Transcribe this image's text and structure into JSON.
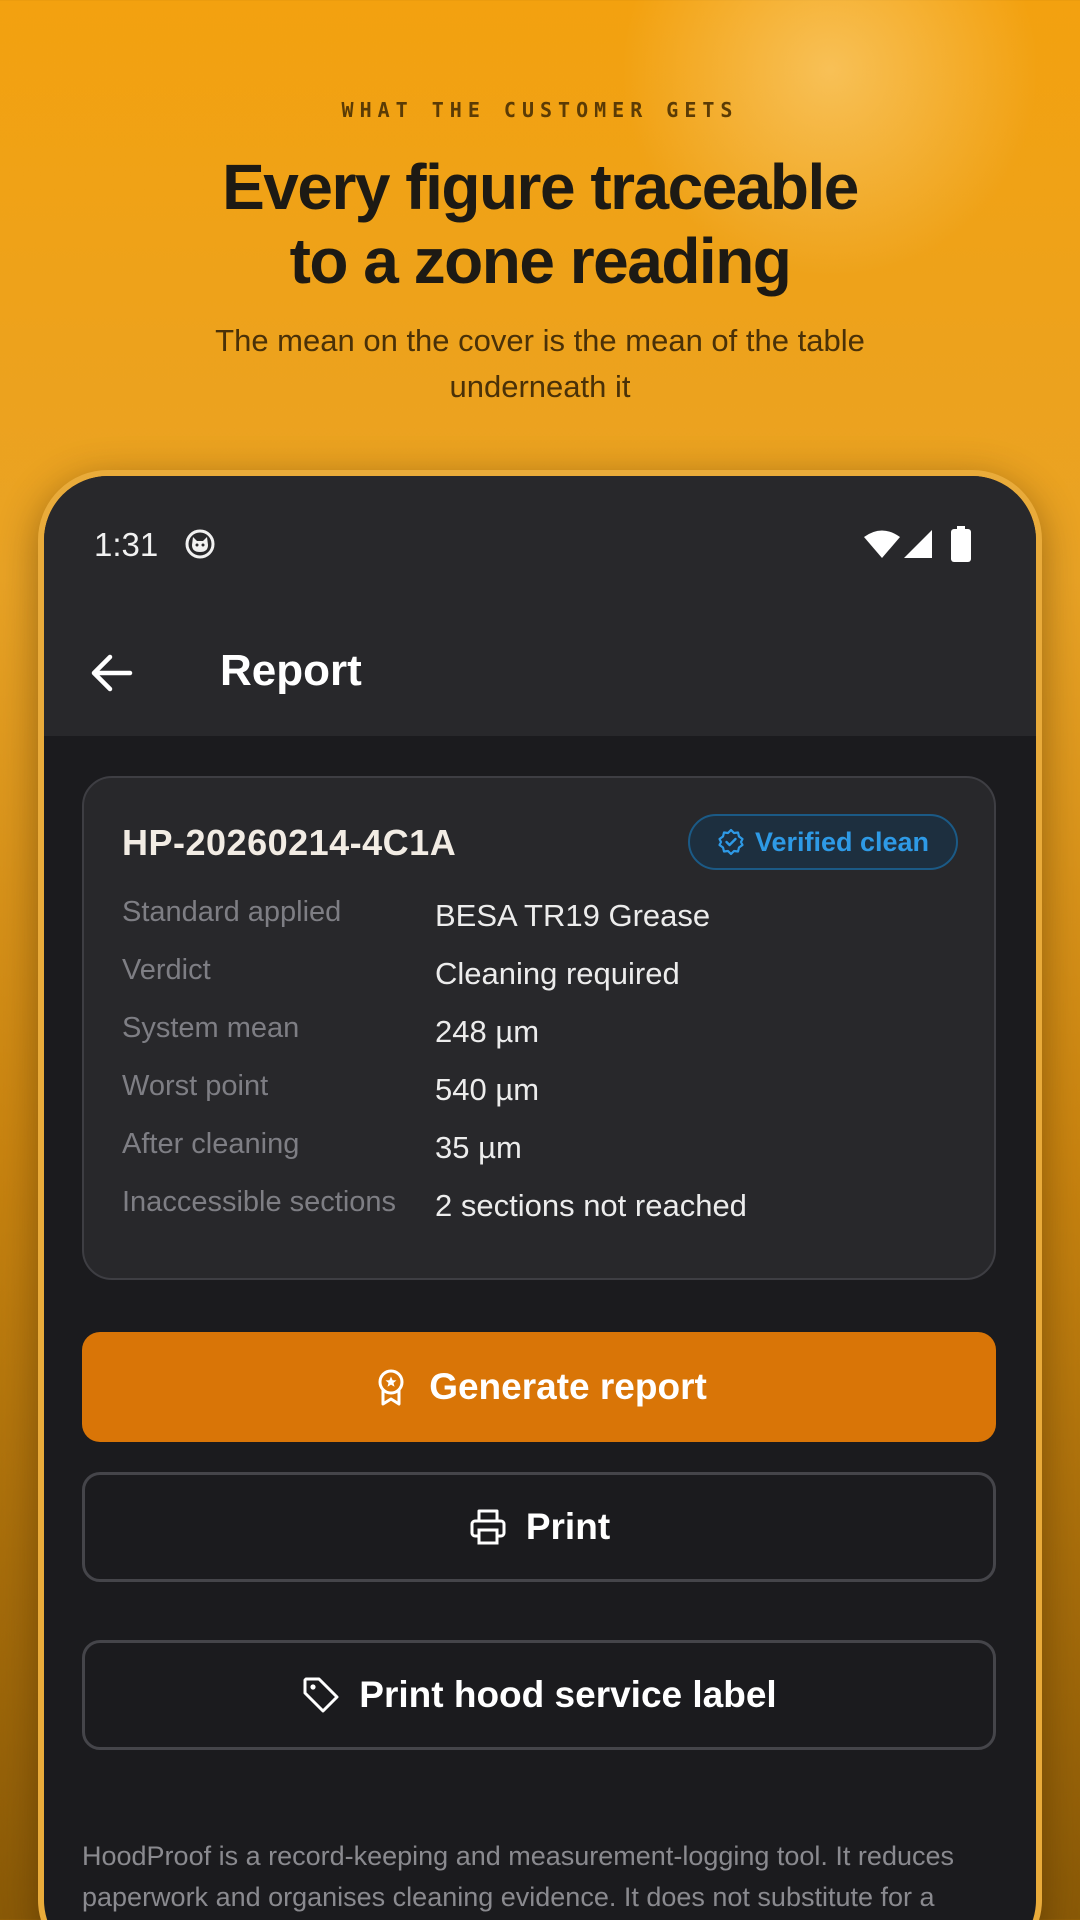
{
  "marketing": {
    "eyebrow": "WHAT THE CUSTOMER GETS",
    "headline_line1": "Every figure traceable",
    "headline_line2": "to a zone reading",
    "subhead": "The mean on the cover is the mean of the table underneath it"
  },
  "statusbar": {
    "time": "1:31",
    "icons": [
      "cat-notification-icon",
      "wifi-icon",
      "signal-icon",
      "battery-icon"
    ]
  },
  "appbar": {
    "title": "Report",
    "back_icon": "arrow-left-icon"
  },
  "report_card": {
    "id": "HP-20260214-4C1A",
    "badge": {
      "label": "Verified clean",
      "icon": "verified-check-icon",
      "color": "#2e9ae6"
    },
    "rows": [
      {
        "label": "Standard applied",
        "value": "BESA TR19 Grease"
      },
      {
        "label": "Verdict",
        "value": "Cleaning required"
      },
      {
        "label": "System mean",
        "value": "248 µm"
      },
      {
        "label": "Worst point",
        "value": "540 µm"
      },
      {
        "label": "After cleaning",
        "value": "35 µm"
      },
      {
        "label": "Inaccessible sections",
        "value": "2 sections not reached"
      }
    ]
  },
  "actions": {
    "generate_label": "Generate report",
    "generate_icon": "award-icon",
    "print_label": "Print",
    "print_icon": "printer-icon",
    "service_label": "Print hood service label",
    "service_icon": "tag-icon"
  },
  "disclaimer": "HoodProof is a record-keeping and measurement-logging tool. It reduces paperwork and organises cleaning evidence. It does not substitute for a competent inspection, it does not certify anything",
  "colors": {
    "accent": "#d97507",
    "background_top": "#f3a10f",
    "phone_surface": "#1b1b1e",
    "card_surface": "#28282b",
    "badge_blue": "#2e9ae6"
  }
}
